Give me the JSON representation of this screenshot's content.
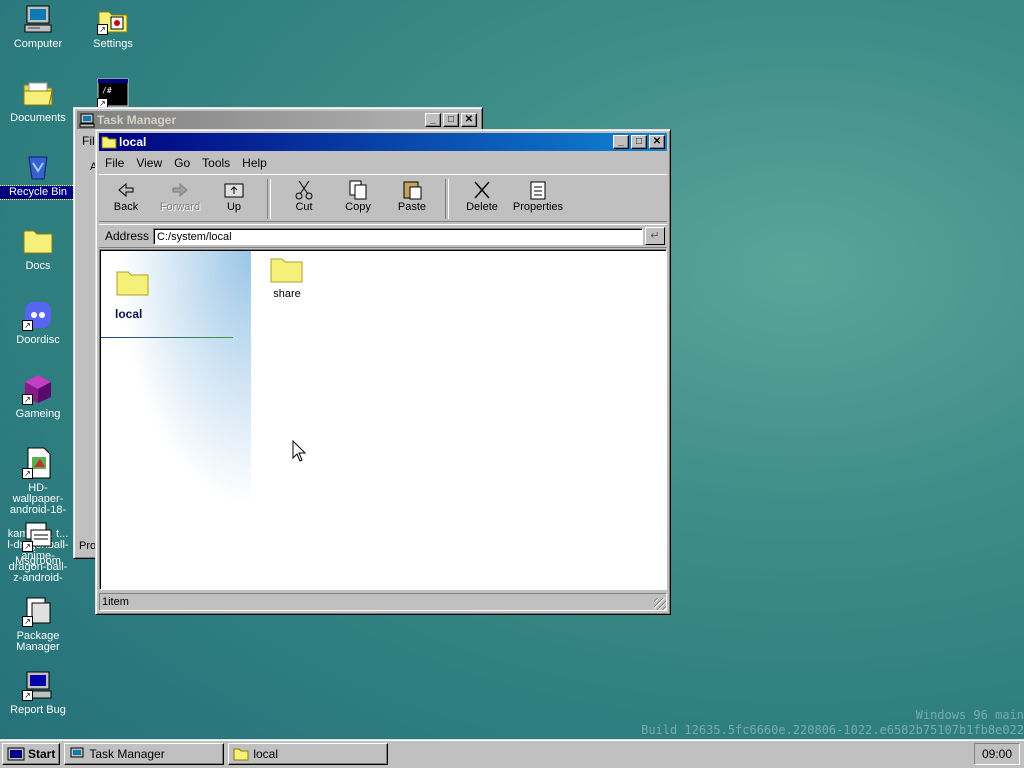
{
  "desktop": {
    "icons": {
      "computer": "Computer",
      "settings": "Settings",
      "documents": "Documents",
      "recycle": "Recycle Bin",
      "docs": "Docs",
      "doordisc": "Doordisc",
      "gameing": "Gameing",
      "wallpaper": "HD-wallpaper-android-18-",
      "kamehameha": "kam...e... t... l-dragonball-anime-dragon-ball-z-android-",
      "msgroom": "Msgroom",
      "package": "Package Manager",
      "report": "Report Bug"
    },
    "watermark_line1": "Windows 96 main",
    "watermark_line2": "Build 12635.5fc6660e.220806-1022.e6582b75107b1fb8e022"
  },
  "task_manager": {
    "title": "Task Manager",
    "menu_partial": "File",
    "left_partial_a": "A",
    "left_partial_pro": "Pro"
  },
  "explorer": {
    "title": "local",
    "menu": [
      "File",
      "View",
      "Go",
      "Tools",
      "Help"
    ],
    "toolbar": {
      "back": "Back",
      "forward": "Forward",
      "up": "Up",
      "cut": "Cut",
      "copy": "Copy",
      "paste": "Paste",
      "delete": "Delete",
      "properties": "Properties"
    },
    "address_label": "Address",
    "address_value": "C:/system/local",
    "side_title": "local",
    "items": [
      {
        "name": "share"
      }
    ],
    "status": "1item"
  },
  "taskbar": {
    "start": "Start",
    "buttons": [
      "Task Manager",
      "local"
    ],
    "clock": "09:00"
  },
  "colors": {
    "desktop": "#2f7f80",
    "title_active": "#000080",
    "folder": "#f5f07a"
  }
}
